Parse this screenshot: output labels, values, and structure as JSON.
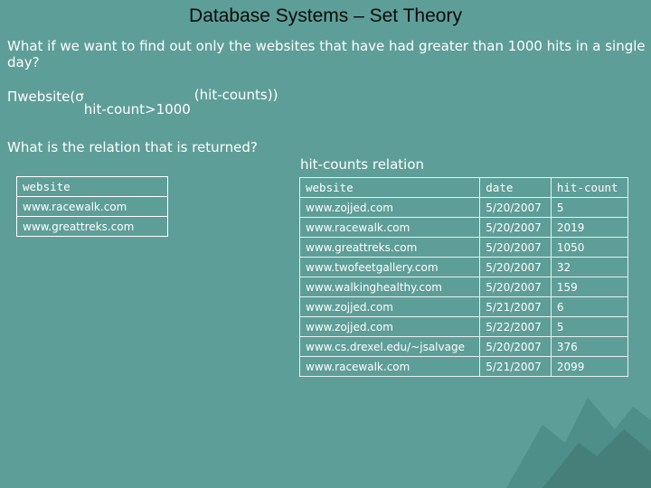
{
  "slide": {
    "title": "Database Systems – Set Theory",
    "question": "What if we want to find out only the websites that have had greater than 1000 hits in a single day?",
    "formula": {
      "pi": "Π",
      "head": "website(σ",
      "subscript": "hit-count>1000",
      "tail": "(hit-counts))"
    },
    "ask": "What is the relation that is returned?",
    "relation_caption": "hit-counts relation"
  },
  "result_table": {
    "header": "website",
    "rows": [
      "www.racewalk.com",
      "www.greattreks.com"
    ]
  },
  "hits_table": {
    "headers": [
      "website",
      "date",
      "hit-count"
    ],
    "rows": [
      [
        "www.zojjed.com",
        "5/20/2007",
        "5"
      ],
      [
        "www.racewalk.com",
        "5/20/2007",
        "2019"
      ],
      [
        "www.greattreks.com",
        "5/20/2007",
        "1050"
      ],
      [
        "www.twofeetgallery.com",
        "5/20/2007",
        "32"
      ],
      [
        "www.walkinghealthy.com",
        "5/20/2007",
        "159"
      ],
      [
        "www.zojjed.com",
        "5/21/2007",
        "6"
      ],
      [
        "www.zojjed.com",
        "5/22/2007",
        "5"
      ],
      [
        "www.cs.drexel.edu/~jsalvage",
        "5/20/2007",
        "376"
      ],
      [
        "www.racewalk.com",
        "5/21/2007",
        "2099"
      ]
    ]
  },
  "colors": {
    "background": "#5e9e98",
    "title_text": "#0a0a0a",
    "body_text": "#ffffff"
  }
}
